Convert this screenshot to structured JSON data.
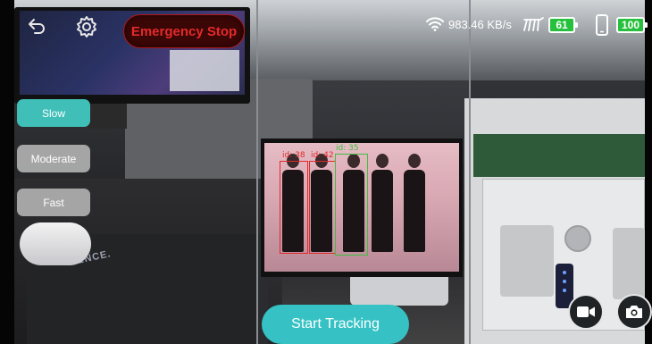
{
  "status_bar": {
    "wifi_icon": "wifi-icon",
    "network_speed": "983.46 KB/s",
    "robot_icon": "robot-dog-icon",
    "robot_battery": "61",
    "phone_icon": "phone-icon",
    "phone_battery": "100",
    "battery_color": "#26c13c"
  },
  "toolbar": {
    "back_icon": "back-arrow-icon",
    "settings_icon": "gear-icon",
    "emergency_stop_label": "Emergency Stop",
    "emergency_stop_color": "#e52a2a"
  },
  "speed_modes": {
    "selected": "Slow",
    "options": [
      "Slow",
      "Moderate",
      "Fast"
    ],
    "active_color": "#3fbfb8"
  },
  "detections": [
    {
      "label": "id: 38",
      "color": "#e02a2a"
    },
    {
      "label": "id: 42",
      "color": "#e02a2a"
    },
    {
      "label": "id: 35",
      "color": "#3fbf3f"
    }
  ],
  "mat_text": "ENCE.",
  "actions": {
    "start_tracking_label": "Start Tracking",
    "record_icon": "video-camera-icon",
    "snapshot_icon": "camera-icon"
  }
}
